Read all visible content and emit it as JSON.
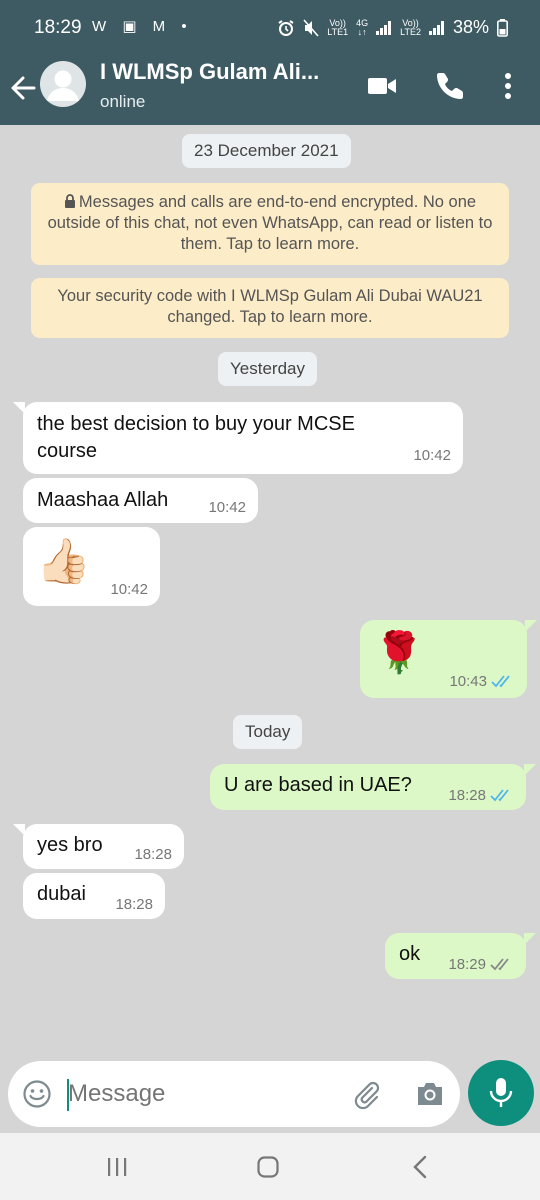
{
  "status_bar": {
    "time": "18:29",
    "left_icons": "W ▣ M •",
    "sim1_top": "Vo))",
    "sim1_bottom": "LTE1",
    "net_top": "4G",
    "net_bottom": "↓↑",
    "sim2_top": "Vo))",
    "sim2_bottom": "LTE2",
    "battery": "38%"
  },
  "header": {
    "contact_name": "I WLMSp Gulam Ali...",
    "contact_status": "online",
    "icons": [
      "back-arrow-icon",
      "avatar",
      "video-call-icon",
      "phone-icon",
      "more-vert-icon"
    ]
  },
  "chat": {
    "date_1": "23 December 2021",
    "notice_encryption": "Messages and calls are end-to-end encrypted. No one outside of this chat, not even WhatsApp, can read or listen to them. Tap to learn more.",
    "notice_security": "Your security code with I WLMSp Gulam Ali Dubai WAU21 changed. Tap to learn more.",
    "date_2": "Yesterday",
    "date_3": "Today",
    "messages": [
      {
        "dir": "in",
        "text_l1": "the best decision to buy your MCSE",
        "text_l2": "course",
        "time": "10:42"
      },
      {
        "dir": "in",
        "text": "Maashaa Allah",
        "time": "10:42"
      },
      {
        "dir": "in",
        "emoji": "👍🏻",
        "time": "10:42"
      },
      {
        "dir": "out",
        "emoji": "🌹",
        "time": "10:43",
        "read": true
      },
      {
        "dir": "out",
        "text": "U are based in UAE?",
        "time": "18:28",
        "read": true
      },
      {
        "dir": "in",
        "text": "yes bro",
        "time": "18:28"
      },
      {
        "dir": "in",
        "text": "dubai",
        "time": "18:28"
      },
      {
        "dir": "out",
        "text": "ok",
        "time": "18:29",
        "read": false
      }
    ]
  },
  "composer": {
    "placeholder": "Message"
  },
  "colors": {
    "header": "#3e5b64",
    "chat_bg": "#d5d5d5",
    "outgoing": "#dcf8c6",
    "incoming": "#ffffff",
    "notice": "#fcecc7",
    "accent": "#0e8f7e",
    "read_ticks": "#4fb6ec"
  }
}
